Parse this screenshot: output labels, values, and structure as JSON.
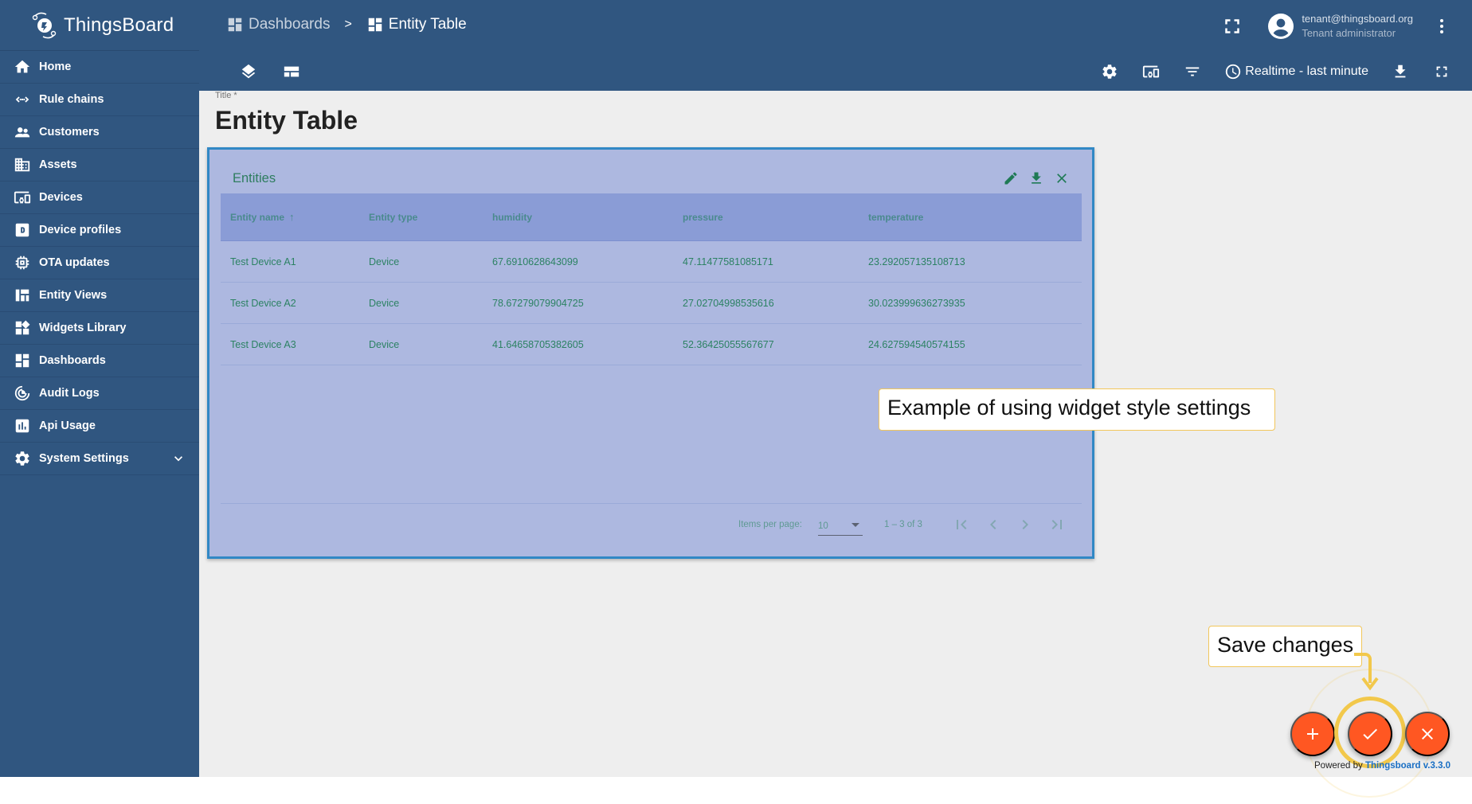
{
  "app": {
    "name": "ThingsBoard"
  },
  "sidebar": {
    "items": [
      {
        "label": "Home",
        "icon": "home-icon"
      },
      {
        "label": "Rule chains",
        "icon": "rule-chains-icon"
      },
      {
        "label": "Customers",
        "icon": "customers-icon"
      },
      {
        "label": "Assets",
        "icon": "assets-icon"
      },
      {
        "label": "Devices",
        "icon": "devices-icon"
      },
      {
        "label": "Device profiles",
        "icon": "device-profiles-icon"
      },
      {
        "label": "OTA updates",
        "icon": "ota-updates-icon"
      },
      {
        "label": "Entity Views",
        "icon": "entity-views-icon"
      },
      {
        "label": "Widgets Library",
        "icon": "widgets-library-icon"
      },
      {
        "label": "Dashboards",
        "icon": "dashboards-icon"
      },
      {
        "label": "Audit Logs",
        "icon": "audit-logs-icon"
      },
      {
        "label": "Api Usage",
        "icon": "api-usage-icon"
      },
      {
        "label": "System Settings",
        "icon": "system-settings-icon",
        "expandable": true
      }
    ]
  },
  "header": {
    "breadcrumb": [
      {
        "label": "Dashboards"
      },
      {
        "label": "Entity Table"
      }
    ],
    "breadcrumb_separator": ">",
    "user": {
      "email": "tenant@thingsboard.org",
      "role": "Tenant administrator"
    }
  },
  "toolbar": {
    "timewindow_label": "Realtime - last minute"
  },
  "title_field": {
    "label": "Title *",
    "value": "Entity Table"
  },
  "widget": {
    "title": "Entities",
    "columns": [
      "Entity name",
      "Entity type",
      "humidity",
      "pressure",
      "temperature"
    ],
    "sort_indicator": "↑",
    "rows": [
      [
        "Test Device A1",
        "Device",
        "67.6910628643099",
        "47.11477581085171",
        "23.292057135108713"
      ],
      [
        "Test Device A2",
        "Device",
        "78.67279079904725",
        "27.02704998535616",
        "30.023999636273935"
      ],
      [
        "Test Device A3",
        "Device",
        "41.64658705382605",
        "52.36425055567677",
        "24.627594540574155"
      ]
    ],
    "paginator": {
      "items_per_page_label": "Items per page:",
      "items_per_page_value": "10",
      "range_label": "1 – 3 of 3"
    },
    "colors": {
      "background": "#adb8e0",
      "header_background": "#8a9cd6",
      "text": "#2c8263",
      "border": "#3188c5"
    }
  },
  "callouts": {
    "widget_style": "Example of using widget style settings",
    "save": "Save changes"
  },
  "footer": {
    "powered_prefix": "Powered by ",
    "powered_link": "Thingsboard v.3.3.0"
  },
  "colors": {
    "primary": "#305680",
    "fab": "#ff5722",
    "highlight": "#f2c84b"
  }
}
